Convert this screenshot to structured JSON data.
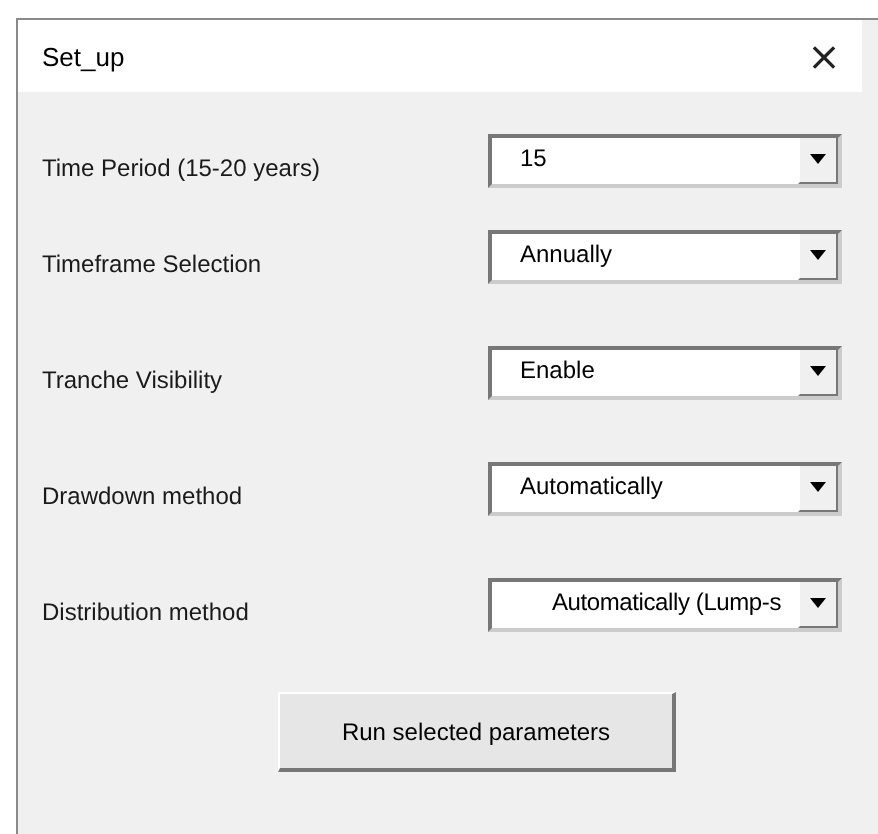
{
  "window": {
    "title": "Set_up",
    "close": "×"
  },
  "fields": [
    {
      "label": "Time Period (15-20 years)",
      "value": "15"
    },
    {
      "label": "Timeframe Selection",
      "value": "Annually"
    },
    {
      "label": "Tranche Visibility",
      "value": "Enable"
    },
    {
      "label": "Drawdown method",
      "value": "Automatically"
    },
    {
      "label": "Distribution method",
      "value": "Automatically (Lump-s"
    }
  ],
  "button": "Run selected parameters"
}
